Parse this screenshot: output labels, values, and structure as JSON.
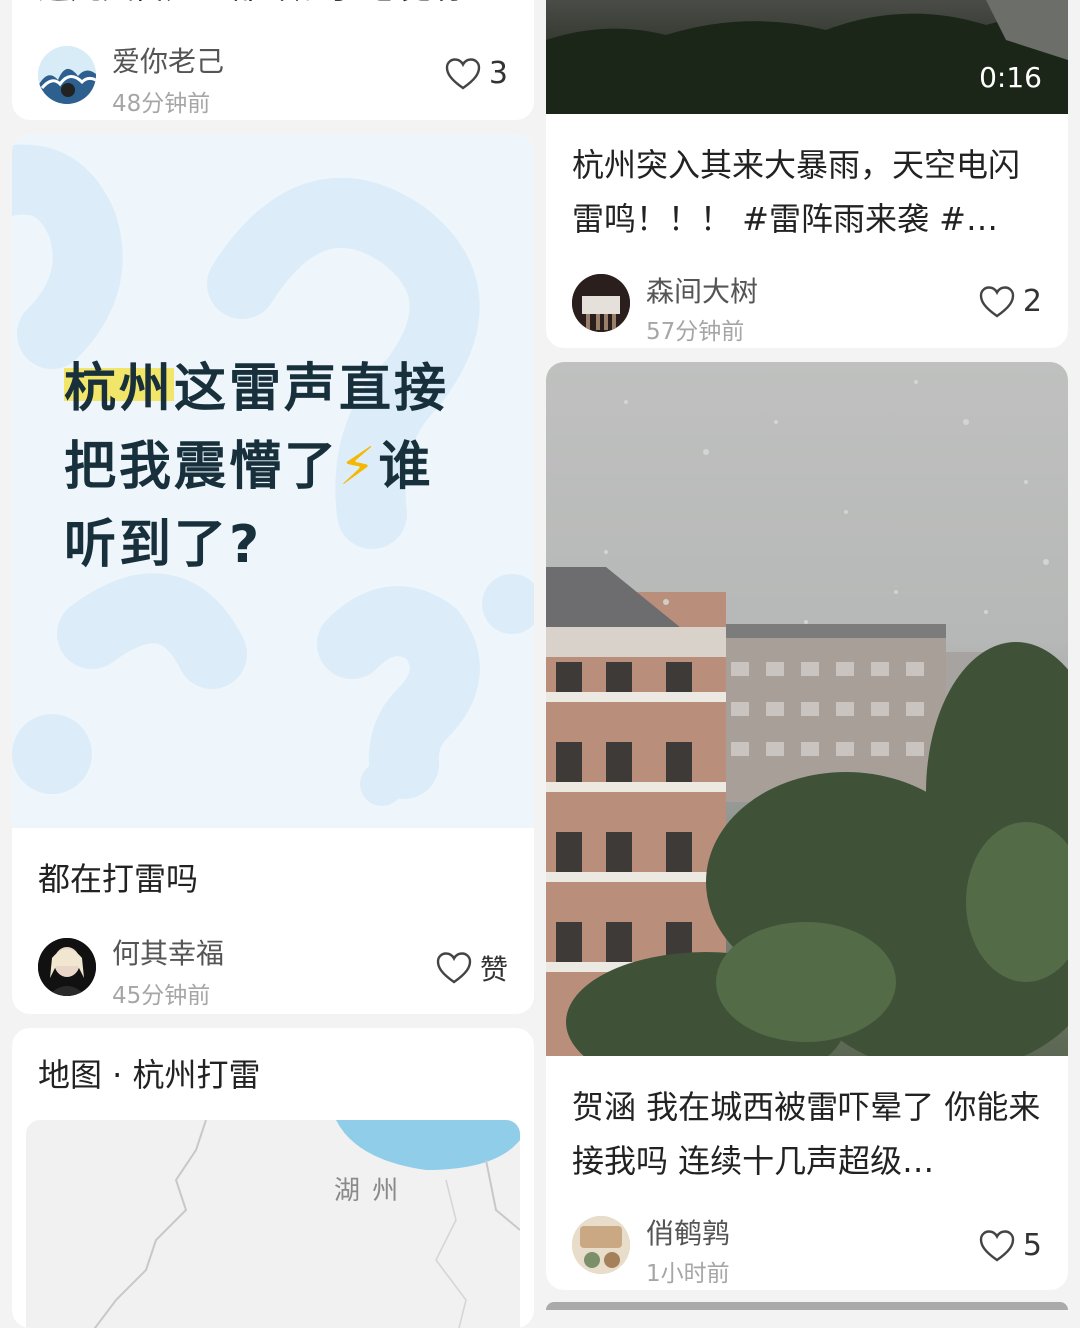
{
  "left": {
    "card1": {
      "title_partial": "这几天雷声…都吓醒了 感觉有点…",
      "user": "爱你老己",
      "time": "48分钟前",
      "likes": "3"
    },
    "card2": {
      "cover_lines": [
        "杭州这雷声直接",
        "把我震懵了",
        "听到了?"
      ],
      "cover_highlight": "杭州",
      "cover_emoji": "⚡",
      "cover_after_emoji": "谁",
      "title": "都在打雷吗",
      "user": "何其幸福",
      "time": "45分钟前",
      "likes": "赞"
    },
    "card3": {
      "title": "地图 · 杭州打雷",
      "map_label": "湖 州"
    }
  },
  "right": {
    "card1": {
      "duration": "0:16",
      "title": "杭州突入其来大暴雨，天空电闪雷鸣！！！ #雷阵雨来袭 #…",
      "user": "森间大树",
      "time": "57分钟前",
      "likes": "2"
    },
    "card2": {
      "title": "贺涵 我在城西被雷吓晕了 你能来接我吗 连续十几声超级…",
      "user": "俏鹌鹑",
      "time": "1小时前",
      "likes": "5"
    }
  },
  "colors": {
    "background": "#f3f3f4",
    "cover_bg": "#eef6fc",
    "cover_text": "#17303c",
    "highlight": "#f2e66a",
    "map_water": "#8fcde8"
  }
}
